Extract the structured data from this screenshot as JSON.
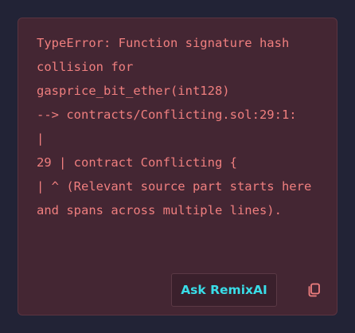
{
  "error": {
    "message": "TypeError: Function signature hash collision for gasprice_bit_ether(int128)\n--> contracts/Conflicting.sol:29:1:\n|\n29 | contract Conflicting {\n| ^ (Relevant source part starts here and spans across multiple lines).",
    "text_color": "#f07f7f",
    "background_color": "#442633"
  },
  "actions": {
    "ask_label": "Ask RemixAI",
    "ask_color": "#39dde8",
    "copy_icon": "copy-icon"
  }
}
